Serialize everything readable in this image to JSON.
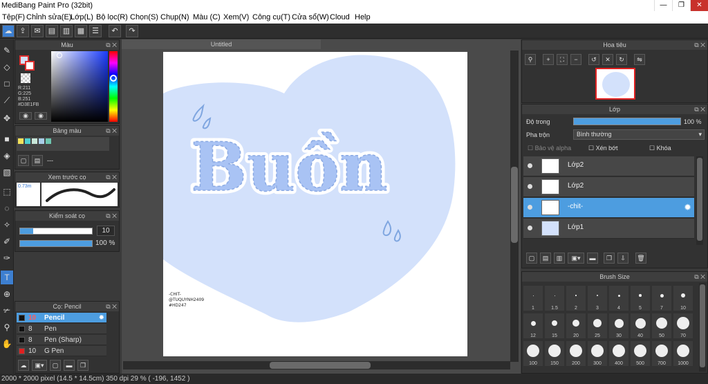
{
  "app": {
    "title": "MediBang Paint Pro (32bit)"
  },
  "menu": [
    "Tệp(F)",
    "Chỉnh sửa(E)",
    "Lớp(L)",
    "Bộ lọc(R)",
    "Chọn(S)",
    "Chụp(N)",
    "Màu (C)",
    "Xem(V)",
    "Công cụ(T)",
    "Cửa sổ(W)",
    "Cloud",
    "Help"
  ],
  "color_panel": {
    "title": "Màu",
    "r": "R:211",
    "g": "G:225",
    "b": "B:251",
    "hex": "#D3E1FB"
  },
  "palette_panel": {
    "title": "Bảng màu",
    "dash": "---"
  },
  "brush_preview": {
    "title": "Xem trước cọ",
    "size": "0.73m"
  },
  "brush_control": {
    "title": "Kiểm soát cọ",
    "size": "10",
    "opacity": "100 %"
  },
  "brush_panel": {
    "title": "Cọ: Pencil",
    "items": [
      {
        "size": "10",
        "name": "Pencil",
        "color": "#111111"
      },
      {
        "size": "8",
        "name": "Pen",
        "color": "#111111"
      },
      {
        "size": "8",
        "name": "Pen (Sharp)",
        "color": "#111111"
      },
      {
        "size": "10",
        "name": "G Pen",
        "color": "#e02020"
      }
    ]
  },
  "document": {
    "tab": "Untitled",
    "art_text": "Buồn",
    "signature": [
      "-CHIT-",
      "@TUQUYNH2409",
      "#HD247"
    ]
  },
  "status": "2000 * 2000 pixel  (14.5 * 14.5cm)  350 dpi  29 %  ( -196, 1452 )",
  "navigator": {
    "title": "Hoa tiêu"
  },
  "layer_panel": {
    "title": "Lớp",
    "opacity_label": "Độ trong",
    "opacity_value": "100 %",
    "blend_label": "Pha trộn",
    "blend_value": "Bình thường",
    "protect_alpha": "Bảo vệ alpha",
    "clipping": "Xén bớt",
    "lock": "Khóa",
    "layers": [
      {
        "name": "Lớp2"
      },
      {
        "name": "Lớp2"
      },
      {
        "name": "-chit-"
      },
      {
        "name": "Lớp1"
      }
    ]
  },
  "brush_size_panel": {
    "title": "Brush Size",
    "sizes": [
      "1",
      "1.5",
      "2",
      "3",
      "4",
      "5",
      "7",
      "10",
      "12",
      "15",
      "20",
      "25",
      "30",
      "40",
      "50",
      "70",
      "100",
      "150",
      "200",
      "300",
      "400",
      "500",
      "700",
      "1000"
    ]
  },
  "colors": {
    "accent": "#4d9de0",
    "art_fill": "#d3e1fb",
    "selected_layer": "#4d9de0"
  }
}
